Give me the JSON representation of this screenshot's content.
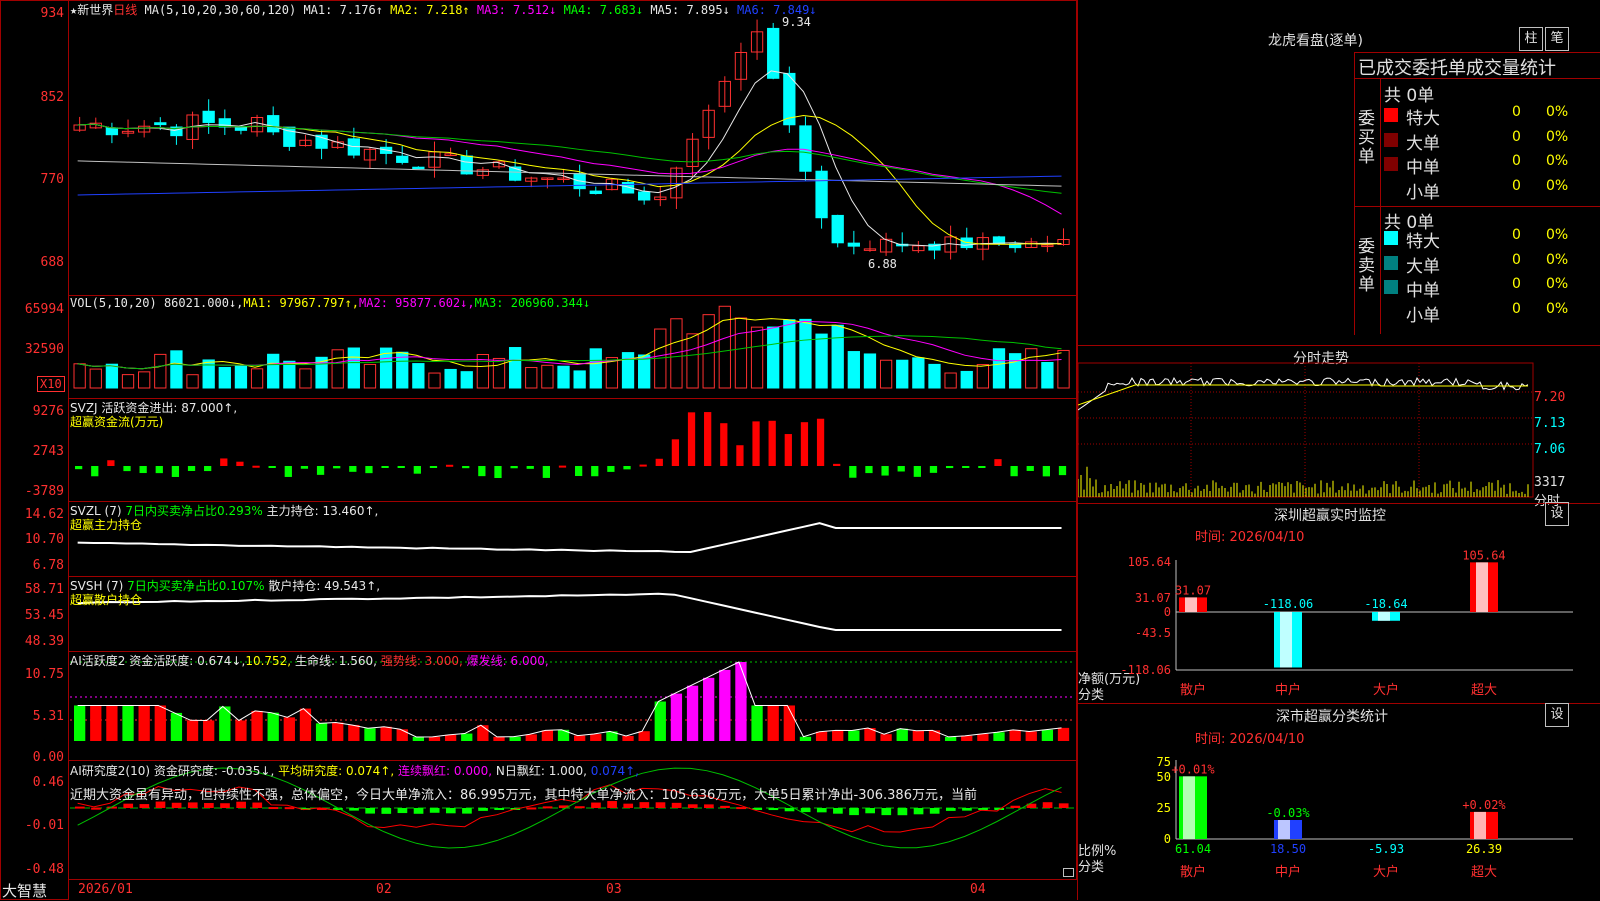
{
  "main": {
    "title_star": "★",
    "stock_name": "新世界",
    "period": "日线",
    "ma_label": "MA(5,10,20,30,60,120)",
    "ma1": "MA1: 7.176↑",
    "ma2": "MA2: 7.218↑",
    "ma3": "MA3: 7.512↓",
    "ma4": "MA4: 7.683↓",
    "ma5": "MA5: 7.895↓",
    "ma6": "MA6: 7.849↓",
    "y_ticks": [
      "934",
      "852",
      "770",
      "688"
    ],
    "high_label": "9.34",
    "low_label": "6.88"
  },
  "vol": {
    "label": "VOL(5,10,20)",
    "value": "86021.000↓,",
    "ma1": "MA1: 97967.797↑,",
    "ma2": "MA2: 95877.602↓,",
    "ma3": "MA3: 206960.344↓",
    "y_ticks": [
      "65994",
      "32590"
    ],
    "unit": "X10"
  },
  "svzj": {
    "label": "SVZJ",
    "text": "活跃资金进出: 87.000↑,",
    "sub": "超赢资金流(万元)",
    "y_ticks": [
      "9276",
      "2743",
      "-3789"
    ]
  },
  "svzl": {
    "label": "SVZL (7)",
    "pct": "7日内买卖净占比0.293%",
    "hold": "主力持仓: 13.460↑,",
    "sub": "超赢主力持仓",
    "y_ticks": [
      "14.62",
      "10.70",
      "6.78"
    ]
  },
  "svsh": {
    "label": "SVSH (7)",
    "pct": "7日内买卖净占比0.107%",
    "hold": "散户持仓: 49.543↑,",
    "sub": "超赢散户持仓",
    "y_ticks": [
      "58.71",
      "53.45",
      "48.39"
    ]
  },
  "ai1": {
    "label": "AI活跃度2",
    "act": "资金活跃度: 0.674↓,",
    "v2": "10.752,",
    "life": "生命线: 1.560,",
    "strong": "强势线: 3.000,",
    "burst": "爆发线: 6.000,",
    "y_ticks": [
      "10.75",
      "5.31",
      "0.00"
    ]
  },
  "ai2": {
    "label": "AI研究度2(10)",
    "res": "资金研究度: -0.035↓,",
    "avg": "平均研究度: 0.074↑,",
    "lian": "连续飘红: 0.000,",
    "n": "N日飘红: 1.000,",
    "last": "0.074↑,",
    "comment": "近期大资金虽有异动，但持续性不强，总体偏空，今日大单净流入：86.995万元，其中特大单净流入：105.636万元，大单5日累计净出-306.386万元，当前",
    "y_ticks": [
      "0.46",
      "-0.01",
      "-0.48"
    ]
  },
  "bottom": {
    "brand": "大智慧",
    "dates": [
      "2026/01",
      "02",
      "03",
      "04"
    ]
  },
  "right": {
    "dragon_title": "龙虎看盘(逐单)",
    "btn_zhu": "柱",
    "btn_bi": "笔",
    "stats_title": "已成交委托单成交量统计",
    "buy_side": "委买单",
    "sell_side": "委卖单",
    "buy_total": "共 0单",
    "sell_total": "共 0单",
    "buy_rows": [
      {
        "name": "特大",
        "count": "0",
        "pct": "0%",
        "color": "#ff0000"
      },
      {
        "name": "大单",
        "count": "0",
        "pct": "0%",
        "color": "#800000"
      },
      {
        "name": "中单",
        "count": "0",
        "pct": "0%",
        "color": "#800000"
      },
      {
        "name": "小单",
        "count": "0",
        "pct": "0%",
        "color": "#000000"
      }
    ],
    "sell_rows": [
      {
        "name": "特大",
        "count": "0",
        "pct": "0%",
        "color": "#00ffff"
      },
      {
        "name": "大单",
        "count": "0",
        "pct": "0%",
        "color": "#008080"
      },
      {
        "name": "中单",
        "count": "0",
        "pct": "0%",
        "color": "#008080"
      },
      {
        "name": "小单",
        "count": "0",
        "pct": "0%",
        "color": "#000000"
      }
    ],
    "intraday_title": "分时走势",
    "intraday_ticks": [
      "7.20",
      "7.13",
      "7.06",
      "3317",
      "分时"
    ],
    "monitor_title": "深圳超赢实时监控",
    "monitor_btn": "设",
    "monitor_time": "时间: 2026/04/10",
    "monitor_ticks": [
      "105.64",
      "31.07",
      "0",
      "-43.5",
      "-118.06"
    ],
    "monitor_ylabel": "净额(万元)",
    "monitor_xlabel": "分类",
    "monitor_cats": [
      "散户",
      "中户",
      "大户",
      "超大"
    ],
    "monitor_values": [
      "31.07",
      "-118.06",
      "-18.64",
      "105.64"
    ],
    "class_title": "深市超赢分类统计",
    "class_btn": "设",
    "class_time": "时间: 2026/04/10",
    "class_ticks": [
      "75",
      "50",
      "25",
      "0"
    ],
    "class_ylabel": "比例%",
    "class_xlabel": "分类",
    "class_cats": [
      "散户",
      "中户",
      "大户",
      "超大"
    ],
    "class_values": [
      "61.04",
      "18.50",
      "-5.93",
      "26.39"
    ],
    "class_changes": [
      "+0.01%",
      "-0.03%",
      "",
      "+0.02%"
    ]
  },
  "chart_data": [
    {
      "type": "candlestick",
      "title": "新世界 日线",
      "ylim": [
        6.88,
        9.34
      ],
      "ma": {
        "MA1": 7.176,
        "MA2": 7.218,
        "MA3": 7.512,
        "MA4": 7.683,
        "MA5": 7.895,
        "MA6": 7.849
      },
      "high": 9.34,
      "low": 6.88
    },
    {
      "type": "bar",
      "title": "VOL(5,10,20)",
      "last": 86021.0,
      "ma": {
        "MA1": 97967.797,
        "MA2": 95877.602,
        "MA3": 206960.344
      }
    },
    {
      "type": "bar",
      "title": "深圳超赢实时监控",
      "categories": [
        "散户",
        "中户",
        "大户",
        "超大"
      ],
      "values": [
        31.07,
        -118.06,
        -18.64,
        105.64
      ],
      "ylim": [
        -118.06,
        105.64
      ]
    },
    {
      "type": "bar",
      "title": "深市超赢分类统计",
      "categories": [
        "散户",
        "中户",
        "大户",
        "超大"
      ],
      "values": [
        61.04,
        18.5,
        -5.93,
        26.39
      ],
      "ylim": [
        0,
        75
      ]
    }
  ]
}
